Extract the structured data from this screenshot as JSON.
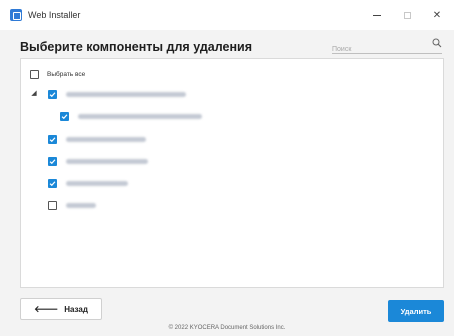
{
  "window": {
    "title": "Web Installer",
    "minimize_icon": "minimize-icon",
    "maximize_icon": "maximize-icon",
    "close_glyph": "✕"
  },
  "header": {
    "title": "Выберите компоненты для удаления",
    "search": {
      "placeholder": "Поиск",
      "icon": "search-icon"
    }
  },
  "list": {
    "select_all": {
      "label": "Выбрать все",
      "checked": false
    },
    "items": [
      {
        "level": 0,
        "expandable": true,
        "expanded": true,
        "checked": true,
        "label_blurred": true
      },
      {
        "level": 1,
        "expandable": false,
        "checked": true,
        "label_blurred": true
      },
      {
        "level": 0,
        "expandable": false,
        "checked": true,
        "label_blurred": true
      },
      {
        "level": 0,
        "expandable": false,
        "checked": true,
        "label_blurred": true
      },
      {
        "level": 0,
        "expandable": false,
        "checked": true,
        "label_blurred": true
      },
      {
        "level": 0,
        "expandable": false,
        "checked": false,
        "label_blurred": true
      }
    ],
    "expand_glyph": "◢"
  },
  "footer": {
    "back_label": "Назад",
    "back_arrow": "🡐",
    "delete_label": "Удалить",
    "copyright": "© 2022 KYOCERA Document Solutions Inc."
  },
  "colors": {
    "accent": "#1b88d8",
    "background": "#f3f3f3",
    "panel": "#ffffff"
  }
}
